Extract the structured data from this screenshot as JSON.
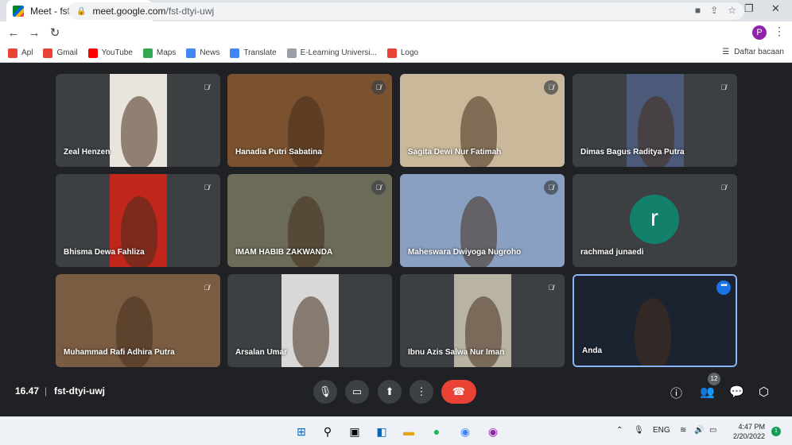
{
  "browser": {
    "tab_title": "Meet - fst-dtyi-uwj",
    "tab_close": "✕",
    "new_tab": "+",
    "url_host": "meet.google.com",
    "url_path": "/fst-dtyi-uwj",
    "profile_initial": "P",
    "bookmarks": [
      {
        "label": "Apl",
        "color": "#ea4335"
      },
      {
        "label": "Gmail",
        "color": "#ea4335"
      },
      {
        "label": "YouTube",
        "color": "#ff0000"
      },
      {
        "label": "Maps",
        "color": "#34a853"
      },
      {
        "label": "News",
        "color": "#4285f4"
      },
      {
        "label": "Translate",
        "color": "#4285f4"
      },
      {
        "label": "E-Learning Universi...",
        "color": "#9aa0a6"
      },
      {
        "label": "Logo",
        "color": "#ea4335"
      }
    ],
    "reading_list": "Daftar bacaan"
  },
  "participants": [
    {
      "name": "Zeal Henzen",
      "muted": true,
      "bg": "#e9e4dc"
    },
    {
      "name": "Hanadia Putri Sabatina",
      "muted": true,
      "bg": "#7a5230"
    },
    {
      "name": "Sagita Dewi Nur Fatimah",
      "muted": true,
      "bg": "#c9b99a"
    },
    {
      "name": "Dimas Bagus Raditya Putra",
      "muted": true,
      "bg": "#4a5a78"
    },
    {
      "name": "Bhisma Dewa Fahliza",
      "muted": true,
      "bg": "#c0261c"
    },
    {
      "name": "IMAM HABIB ZAKWANDA",
      "muted": true,
      "bg": "#6b6b57"
    },
    {
      "name": "Maheswara Dwiyoga Nugroho",
      "muted": true,
      "bg": "#8aa0c2"
    },
    {
      "name": "rachmad junaedi",
      "muted": true,
      "avatar_letter": "r"
    },
    {
      "name": "Muhammad Rafi Adhira Putra",
      "muted": true,
      "bg": "#7a5c42"
    },
    {
      "name": "Arsalan Umar",
      "muted": false,
      "bg": "#d8d8d8"
    },
    {
      "name": "Ibnu Azis Salwa Nur Iman",
      "muted": true,
      "bg": "#b9b3a4"
    },
    {
      "name": "Anda",
      "muted": false,
      "bg": "#1b2230",
      "self": true
    }
  ],
  "meeting": {
    "time": "16.47",
    "separator": "|",
    "code": "fst-dtyi-uwj",
    "people_count": "12"
  },
  "taskbar": {
    "lang": "ENG",
    "time": "4:47 PM",
    "date": "2/20/2022",
    "notifications": "1"
  },
  "colors": {
    "meet_bg": "#202124",
    "tile_bg": "#3c4043",
    "end_call": "#ea4335",
    "active_border": "#8ab4f8"
  }
}
